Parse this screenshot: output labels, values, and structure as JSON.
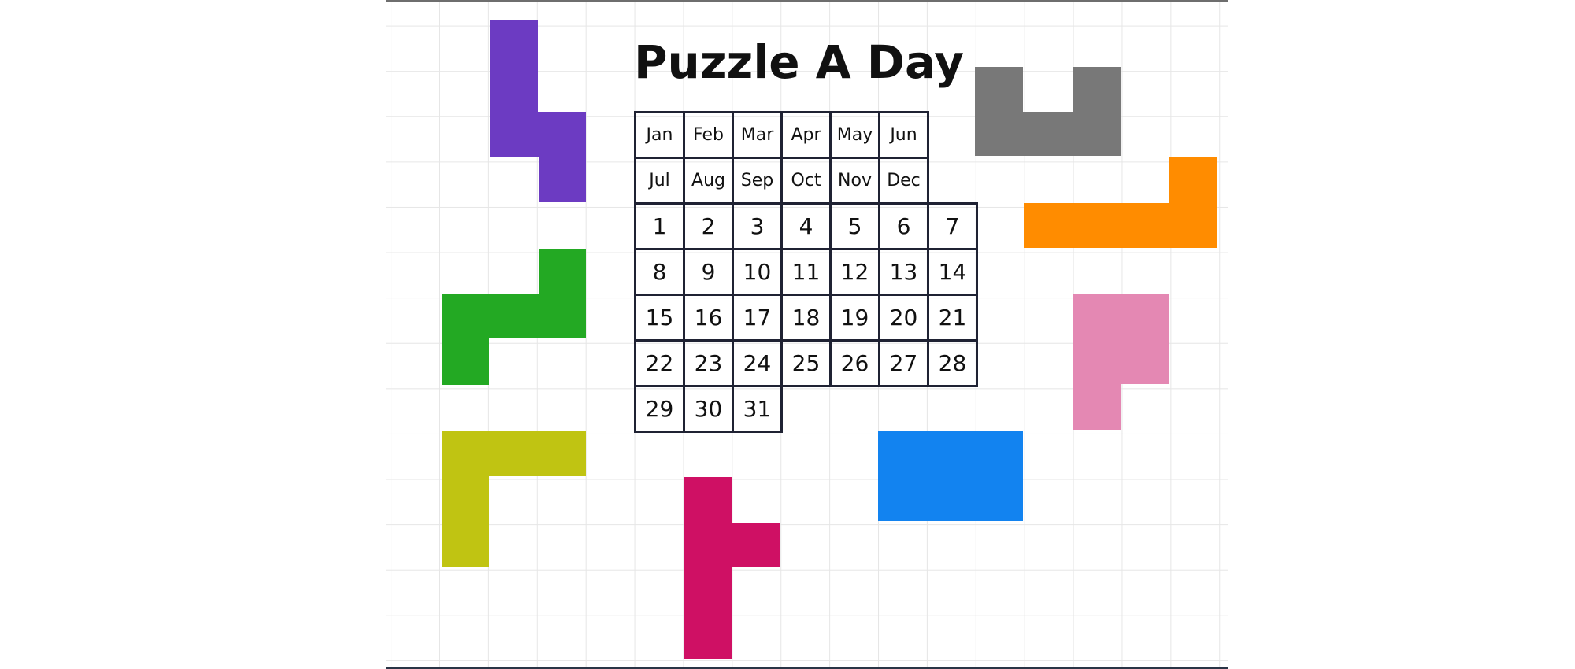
{
  "title": "Puzzle A Day",
  "board": {
    "months": [
      "Jan",
      "Feb",
      "Mar",
      "Apr",
      "May",
      "Jun",
      "Jul",
      "Aug",
      "Sep",
      "Oct",
      "Nov",
      "Dec"
    ],
    "days": [
      "1",
      "2",
      "3",
      "4",
      "5",
      "6",
      "7",
      "8",
      "9",
      "10",
      "11",
      "12",
      "13",
      "14",
      "15",
      "16",
      "17",
      "18",
      "19",
      "20",
      "21",
      "22",
      "23",
      "24",
      "25",
      "26",
      "27",
      "28",
      "29",
      "30",
      "31"
    ]
  },
  "colors": {
    "purple": "#6c3bc2",
    "gray": "#787878",
    "orange": "#ff8c00",
    "green": "#23a923",
    "pink": "#e488b3",
    "yellow": "#c0c412",
    "magenta": "#cf1064",
    "blue": "#1283f0",
    "grid_line": "#e6e6e6",
    "board_line": "#1f2233"
  },
  "pieces": [
    {
      "name": "purple-piece",
      "color": "purple"
    },
    {
      "name": "gray-piece",
      "color": "gray"
    },
    {
      "name": "orange-piece",
      "color": "orange"
    },
    {
      "name": "green-piece",
      "color": "green"
    },
    {
      "name": "pink-piece",
      "color": "pink"
    },
    {
      "name": "yellow-piece",
      "color": "yellow"
    },
    {
      "name": "magenta-piece",
      "color": "magenta"
    },
    {
      "name": "blue-piece",
      "color": "blue"
    }
  ]
}
